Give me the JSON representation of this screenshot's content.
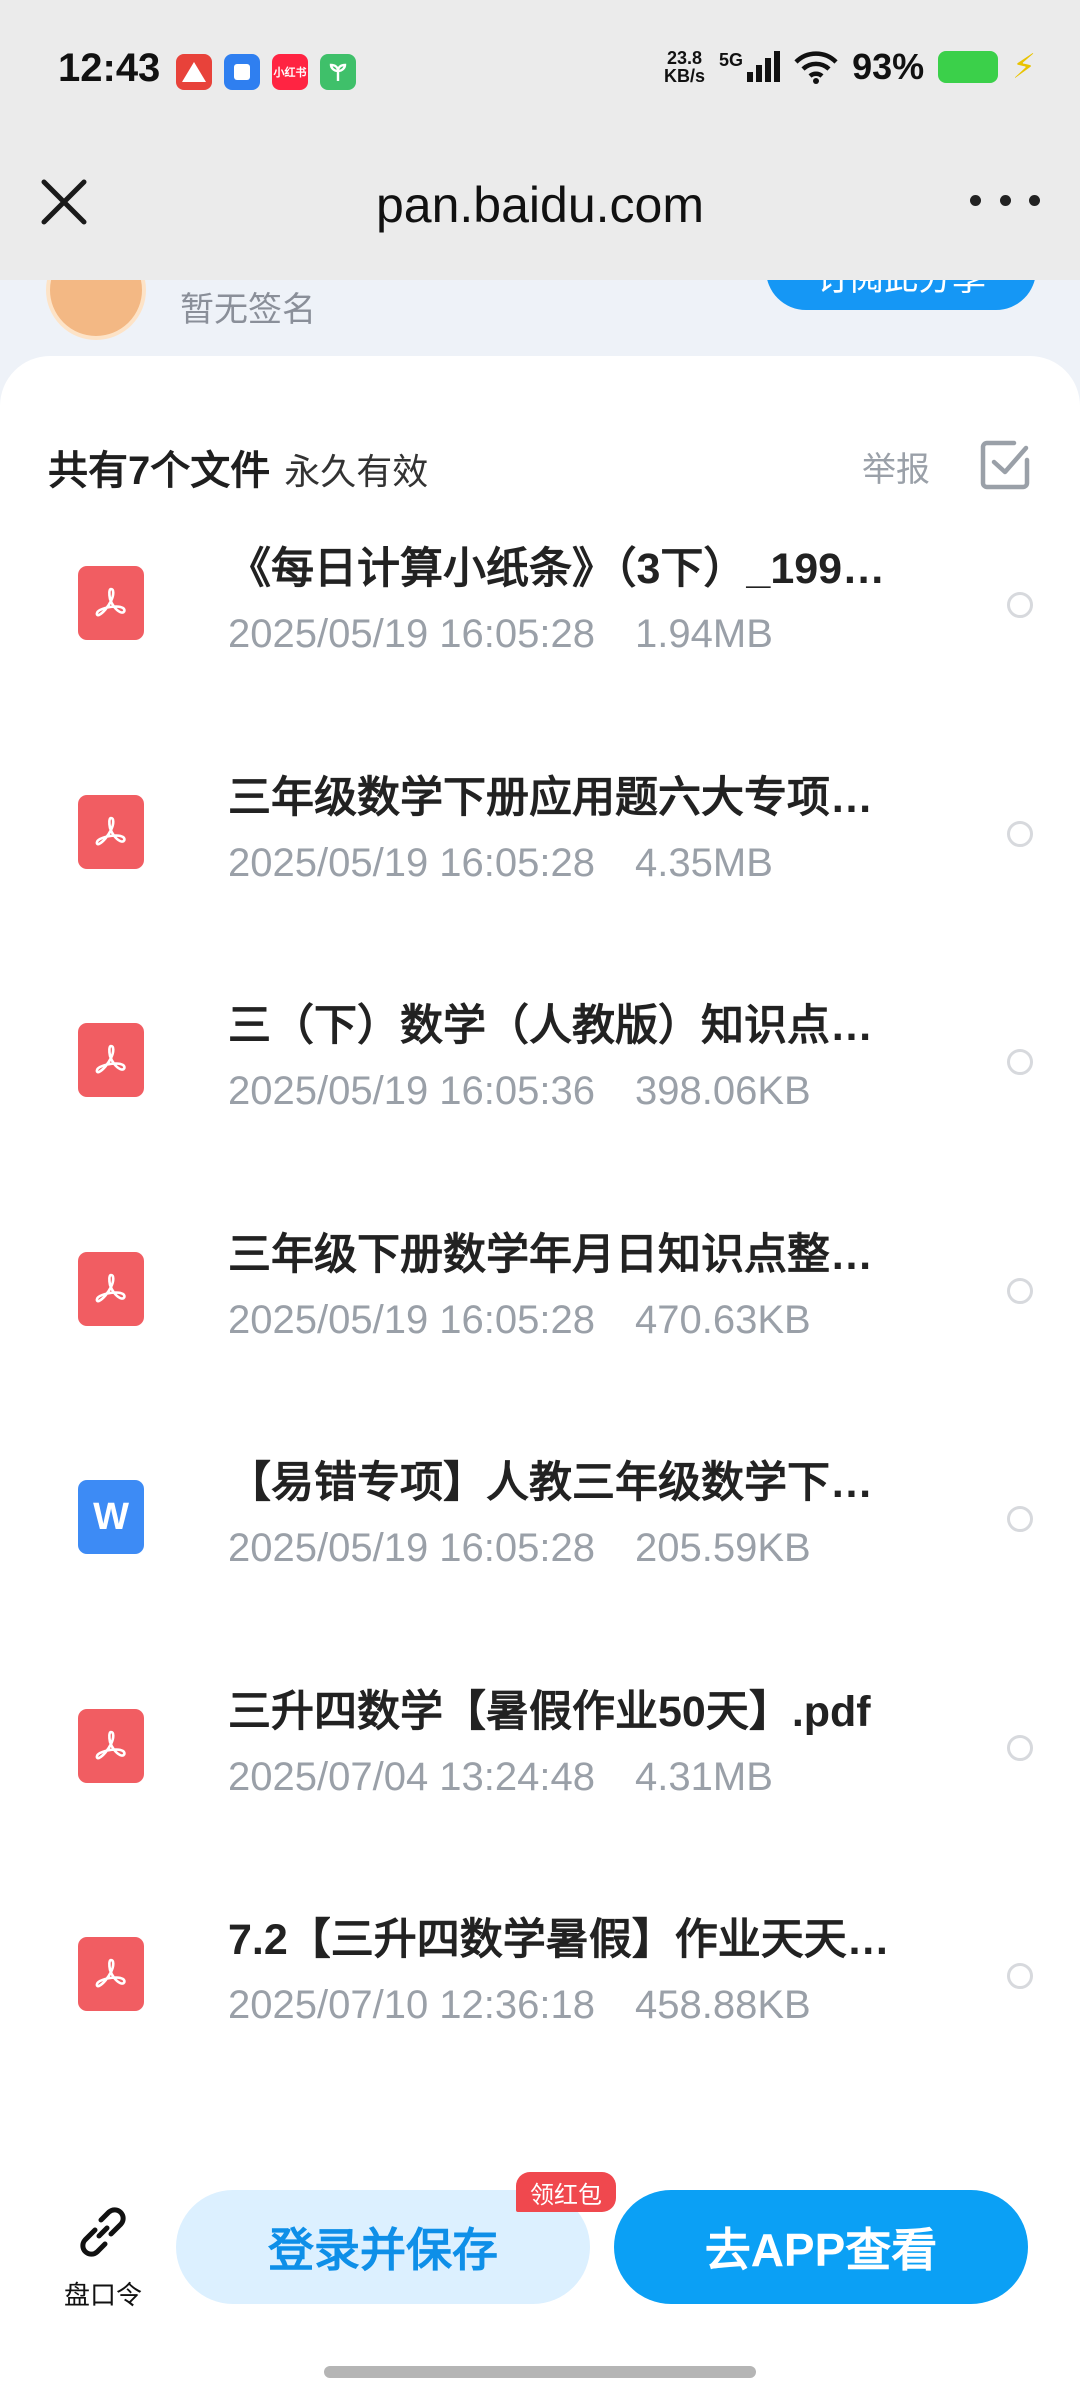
{
  "status_bar": {
    "time": "12:43",
    "app_icons": [
      "red-triangle-app-icon",
      "blue-square-app-icon",
      "xiaohongshu-app-icon",
      "green-sprout-app-icon"
    ],
    "xiaohongshu_text": "小红书",
    "net_speed_value": "23.8",
    "net_speed_unit": "KB/s",
    "network": "5G",
    "battery_pct": "93%",
    "colors": {
      "battery": "#3bd04a",
      "charging": "#e9c300"
    }
  },
  "title_bar": {
    "url": "pan.baidu.com",
    "close_icon": "close-icon",
    "more_icon": "more-icon"
  },
  "profile": {
    "signature": "暂无签名",
    "follow_label": "订阅此分享"
  },
  "header": {
    "file_count": "共有7个文件",
    "validity": "永久有效",
    "report": "举报"
  },
  "files": [
    {
      "type": "pdf",
      "name": "《每日计算小纸条》（3下）_199…",
      "date": "2025/05/19 16:05:28",
      "size": "1.94MB"
    },
    {
      "type": "pdf",
      "name": "三年级数学下册应用题六大专项…",
      "date": "2025/05/19 16:05:28",
      "size": "4.35MB"
    },
    {
      "type": "pdf",
      "name": "三（下）数学（人教版）知识点…",
      "date": "2025/05/19 16:05:36",
      "size": "398.06KB"
    },
    {
      "type": "pdf",
      "name": "三年级下册数学年月日知识点整…",
      "date": "2025/05/19 16:05:28",
      "size": "470.63KB"
    },
    {
      "type": "doc",
      "name": "【易错专项】人教三年级数学下…",
      "date": "2025/05/19 16:05:28",
      "size": "205.59KB",
      "icon_letter": "W"
    },
    {
      "type": "pdf",
      "name": "三升四数学【暑假作业50天】.pdf",
      "date": "2025/07/04 13:24:48",
      "size": "4.31MB"
    },
    {
      "type": "pdf",
      "name": "7.2【三升四数学暑假】作业天天…",
      "date": "2025/07/10 12:36:18",
      "size": "458.88KB"
    }
  ],
  "bottom_bar": {
    "share_code_label": "盘口令",
    "login_save": "登录并保存",
    "red_packet_badge": "领红包",
    "open_app": "去APP查看",
    "colors": {
      "primary": "#0ba0f5",
      "secondary_bg": "#dcf0ff",
      "badge": "#f0484e"
    }
  }
}
